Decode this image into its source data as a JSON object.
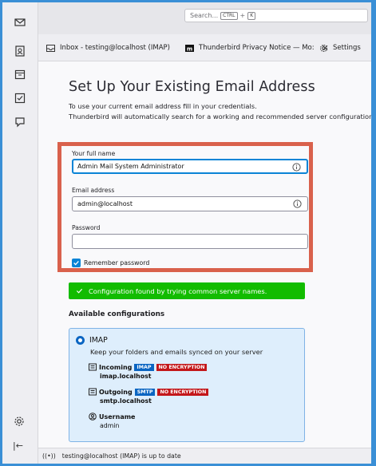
{
  "search": {
    "placeholder": "Search...",
    "kbd_ctrl": "CTRL",
    "kbd_plus": "+",
    "kbd_key": "K"
  },
  "tabs": [
    {
      "label": "Inbox - testing@localhost (IMAP)",
      "icon": "inbox-icon"
    },
    {
      "label": "Thunderbird Privacy Notice — Mo:",
      "icon": "mozilla-icon"
    },
    {
      "label": "Settings",
      "icon": "gear-icon"
    }
  ],
  "page": {
    "title": "Set Up Your Existing Email Address",
    "intro_line1": "To use your current email address fill in your credentials.",
    "intro_line2": "Thunderbird will automatically search for a working and recommended server configuration."
  },
  "form": {
    "full_name_label": "Your full name",
    "full_name_value": "Admin Mail System Administrator",
    "email_label": "Email address",
    "email_value": "admin@localhost",
    "password_label": "Password",
    "password_value": "",
    "remember_label": "Remember password",
    "remember_checked": true
  },
  "success_message": "Configuration found by trying common server names.",
  "available_title": "Available configurations",
  "config": {
    "protocol": "IMAP",
    "description": "Keep your folders and emails synced on your server",
    "incoming_label": "Incoming",
    "incoming_badge": "IMAP",
    "incoming_security": "NO ENCRYPTION",
    "incoming_host": "imap.localhost",
    "outgoing_label": "Outgoing",
    "outgoing_badge": "SMTP",
    "outgoing_security": "NO ENCRYPTION",
    "outgoing_host": "smtp.localhost",
    "username_label": "Username",
    "username_value": "admin"
  },
  "status": {
    "text": "testing@localhost (IMAP) is up to date",
    "icon": "radio-waves-icon"
  },
  "colors": {
    "accent": "#0a84d6",
    "success": "#12bc00",
    "highlight_border": "#d9614c",
    "badge_blue": "#0a65c2",
    "badge_red": "#c3171a"
  }
}
